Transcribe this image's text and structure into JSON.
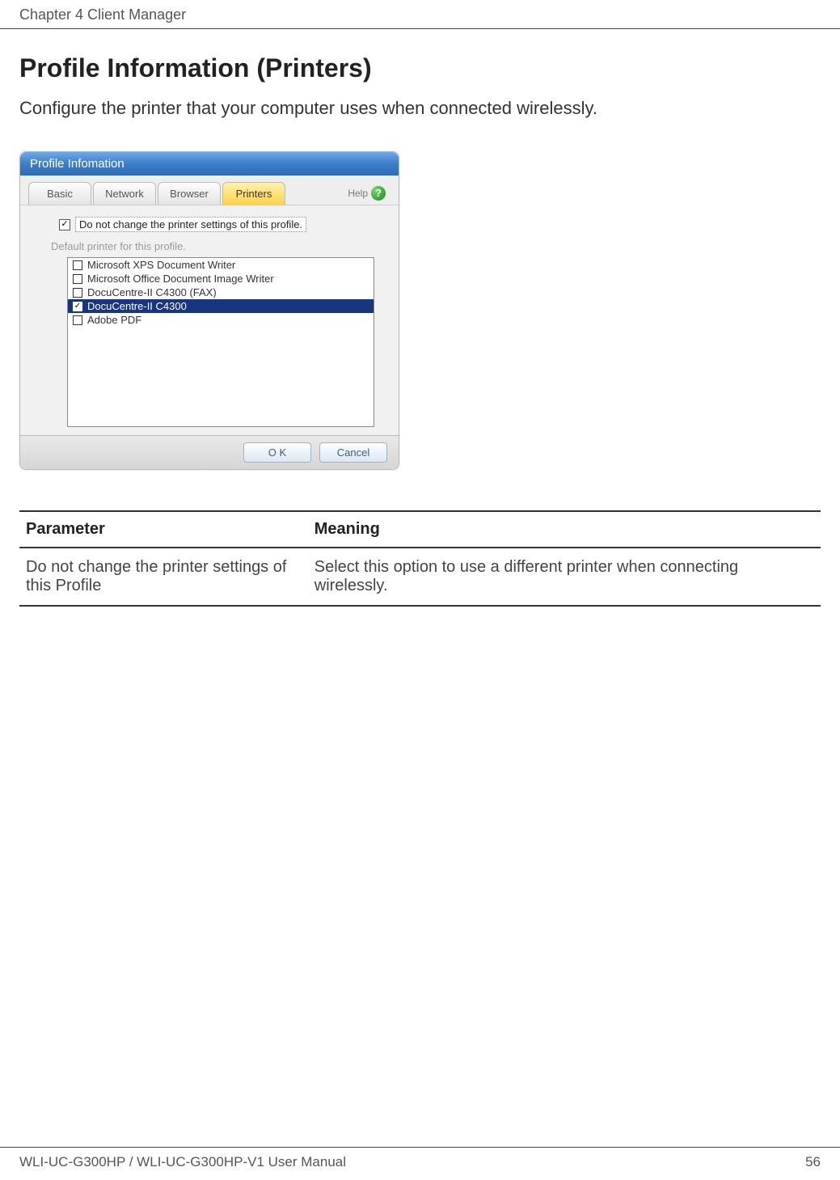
{
  "header": {
    "chapter": "Chapter 4  Client Manager"
  },
  "section": {
    "title": "Profile Information (Printers)",
    "intro": "Configure the printer that your computer uses when connected wirelessly."
  },
  "dialog": {
    "title": "Profile Infomation",
    "tabs": [
      {
        "label": "Basic",
        "active": false
      },
      {
        "label": "Network",
        "active": false
      },
      {
        "label": "Browser",
        "active": false
      },
      {
        "label": "Printers",
        "active": true
      }
    ],
    "help_label": "Help",
    "checkbox": {
      "checked": true,
      "label": "Do not change the printer settings of this profile."
    },
    "subtext": "Default printer for this profile.",
    "printers": [
      {
        "label": "Microsoft XPS Document Writer",
        "checked": false,
        "selected": false
      },
      {
        "label": "Microsoft Office Document Image Writer",
        "checked": false,
        "selected": false
      },
      {
        "label": "DocuCentre-II C4300 (FAX)",
        "checked": false,
        "selected": false
      },
      {
        "label": "DocuCentre-II C4300",
        "checked": true,
        "selected": true
      },
      {
        "label": "Adobe PDF",
        "checked": false,
        "selected": false
      }
    ],
    "buttons": {
      "ok": "O K",
      "cancel": "Cancel"
    }
  },
  "param_table": {
    "headers": {
      "param": "Parameter",
      "meaning": "Meaning"
    },
    "rows": [
      {
        "param": "Do not change the printer settings of this Profile",
        "meaning": "Select this option to use a different printer when connecting wirelessly."
      }
    ]
  },
  "footer": {
    "manual": "WLI-UC-G300HP / WLI-UC-G300HP-V1 User Manual",
    "page": "56"
  }
}
